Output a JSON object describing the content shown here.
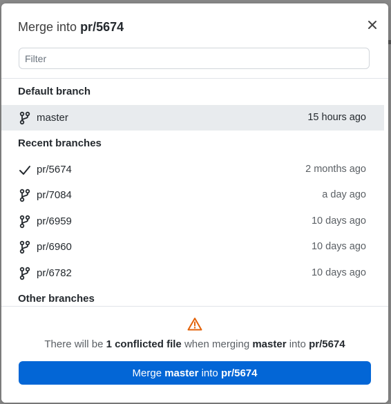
{
  "dialog": {
    "title_prefix": "Merge into",
    "title_target": "pr/5674",
    "close_label": "×"
  },
  "filter": {
    "placeholder": "Filter",
    "value": ""
  },
  "sections": {
    "default": "Default branch",
    "recent": "Recent branches",
    "other": "Other branches"
  },
  "default_branch": {
    "name": "master",
    "time": "15 hours ago",
    "icon": "git-branch-icon"
  },
  "recent_branches": [
    {
      "name": "pr/5674",
      "time": "2 months ago",
      "icon": "check-icon"
    },
    {
      "name": "pr/7084",
      "time": "a day ago",
      "icon": "git-branch-icon"
    },
    {
      "name": "pr/6959",
      "time": "10 days ago",
      "icon": "git-branch-icon"
    },
    {
      "name": "pr/6960",
      "time": "10 days ago",
      "icon": "git-branch-icon"
    },
    {
      "name": "pr/6782",
      "time": "10 days ago",
      "icon": "git-branch-icon"
    }
  ],
  "status": {
    "icon": "warning-icon",
    "part1": "There will be ",
    "count_text": "1 conflicted file",
    "part2": " when merging ",
    "source": "master",
    "part3": " into ",
    "target": "pr/5674"
  },
  "merge_button": {
    "part1": "Merge ",
    "source": "master",
    "part2": " into ",
    "target": "pr/5674"
  },
  "colors": {
    "primary": "#0366d6",
    "selected_row": "#e8ebee",
    "warning": "#e36209"
  }
}
